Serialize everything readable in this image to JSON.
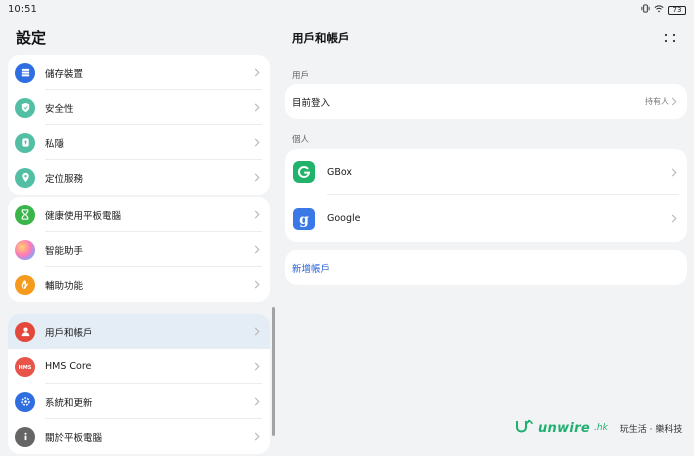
{
  "status_bar": {
    "time": "10:51",
    "battery": "73"
  },
  "settings": {
    "title": "設定",
    "groups": [
      [
        {
          "label": "儲存裝置",
          "icon": "storage-icon",
          "color": "#2f6ee0"
        },
        {
          "label": "安全性",
          "icon": "shield-icon",
          "color": "#52bfa5"
        },
        {
          "label": "私隱",
          "icon": "privacy-icon",
          "color": "#52bfa5"
        },
        {
          "label": "定位服務",
          "icon": "location-icon",
          "color": "#52bfa5"
        }
      ],
      [
        {
          "label": "健康使用平板電腦",
          "icon": "hourglass-icon",
          "color": "#3bb54a"
        },
        {
          "label": "智能助手",
          "icon": "assistant-icon",
          "color": "#a78bfa"
        },
        {
          "label": "輔助功能",
          "icon": "hand-icon",
          "color": "#f59a1d"
        }
      ],
      [
        {
          "label": "用戶和帳戶",
          "icon": "user-icon",
          "color": "#e4473b",
          "selected": true
        },
        {
          "label": "HMS Core",
          "icon": "hms-icon",
          "color": "#e8534a"
        },
        {
          "label": "系統和更新",
          "icon": "system-update-icon",
          "color": "#2f6ee0"
        },
        {
          "label": "關於平板電腦",
          "icon": "info-icon",
          "color": "#666666"
        }
      ]
    ]
  },
  "accounts": {
    "title": "用戶和帳戶",
    "user_section": "用戶",
    "current_login": {
      "label": "目前登入",
      "value": "持有人"
    },
    "personal_section": "個人",
    "personal": [
      {
        "label": "GBox",
        "icon": "gbox-icon",
        "color": "#21b36b"
      },
      {
        "label": "Google",
        "icon": "google-icon",
        "color": "#3b78e7"
      }
    ],
    "add_account": "新增帳戶"
  },
  "watermark": {
    "brand": "unwire",
    "tld": ".hk",
    "slogan": "玩生活 ‧ 樂科技"
  }
}
